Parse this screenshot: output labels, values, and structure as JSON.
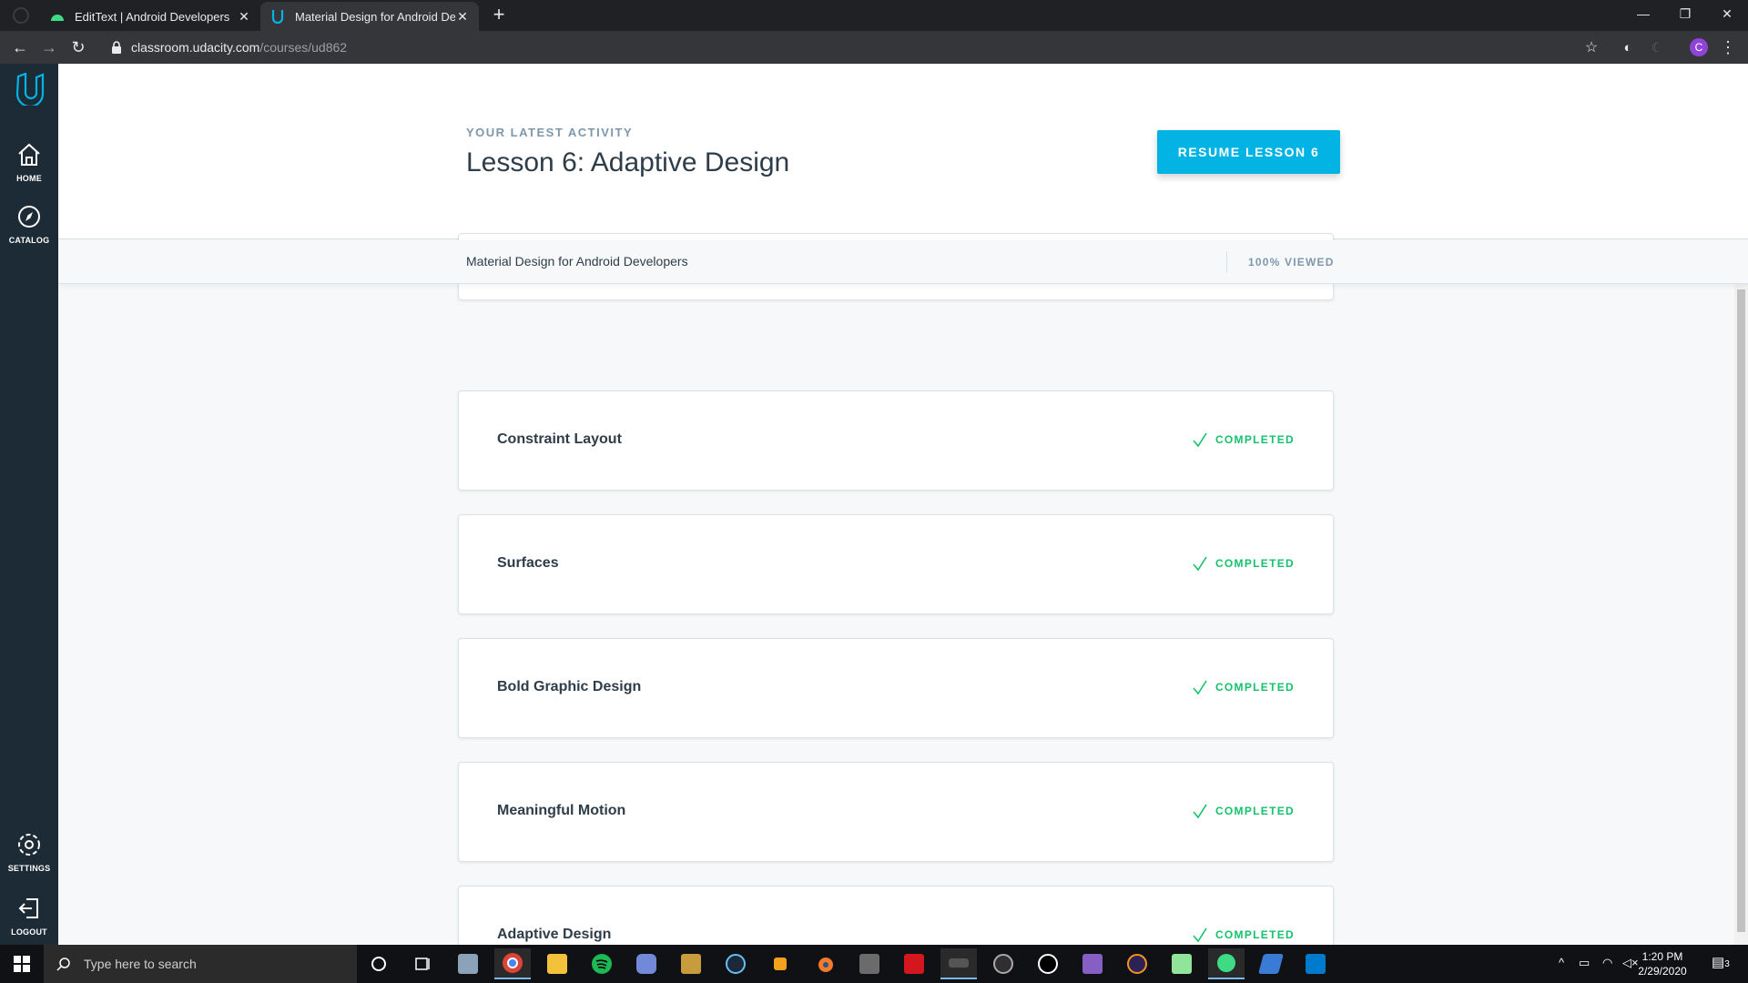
{
  "browser": {
    "tabs": [
      {
        "title": "EditText | Android Developers",
        "icon": "android-studio-icon"
      },
      {
        "title": "Material Design for Android Dev",
        "icon": "udacity-icon",
        "active": true
      }
    ],
    "new_tab": "+",
    "url_host": "classroom.udacity.com",
    "url_path": "/courses/ud862",
    "profile_initial": "C"
  },
  "sidenav": {
    "items": [
      {
        "label": "HOME",
        "icon": "home-icon"
      },
      {
        "label": "CATALOG",
        "icon": "compass-icon"
      },
      {
        "label": "SETTINGS",
        "icon": "gear-icon"
      },
      {
        "label": "LOGOUT",
        "icon": "logout-icon"
      }
    ]
  },
  "header": {
    "eyebrow": "YOUR LATEST ACTIVITY",
    "title": "Lesson 6: Adaptive Design",
    "resume_label": "RESUME LESSON 6"
  },
  "subbar": {
    "course": "Material Design for Android Developers",
    "viewed": "100% VIEWED"
  },
  "lessons": [
    {
      "title": "Constraint Layout",
      "status": "COMPLETED"
    },
    {
      "title": "Surfaces",
      "status": "COMPLETED"
    },
    {
      "title": "Bold Graphic Design",
      "status": "COMPLETED"
    },
    {
      "title": "Meaningful Motion",
      "status": "COMPLETED"
    },
    {
      "title": "Adaptive Design",
      "status": "COMPLETED"
    }
  ],
  "taskbar": {
    "search_placeholder": "Type here to search",
    "time": "1:20 PM",
    "date": "2/29/2020",
    "notifications": "3"
  },
  "colors": {
    "accent": "#02b3e4",
    "completed": "#15c26b",
    "sidenav": "#1d2b36"
  }
}
